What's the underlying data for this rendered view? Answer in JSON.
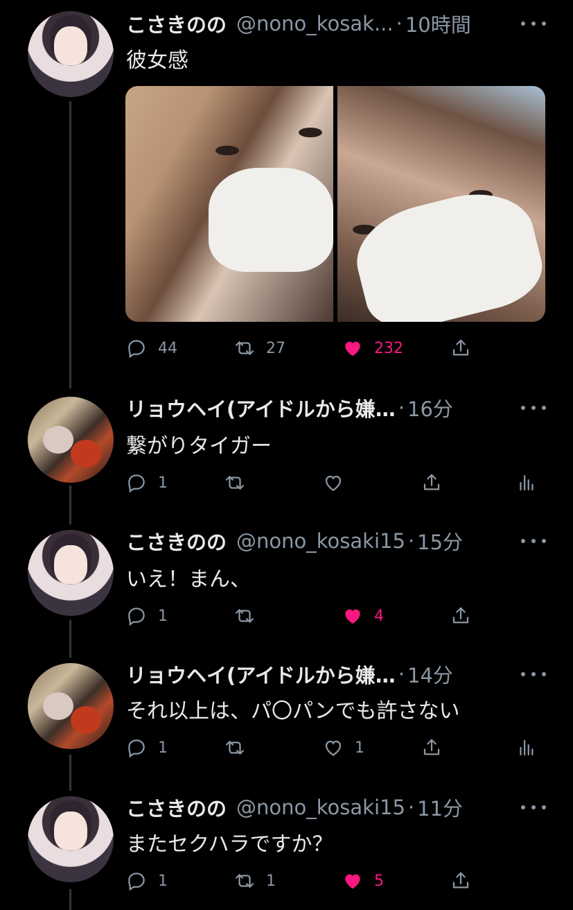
{
  "thread": [
    {
      "kind": "nono",
      "name": "こさきのの",
      "handle": "@nono_kosak...",
      "time": "10時間",
      "text": "彼女感",
      "has_media": true,
      "reply_count": "44",
      "retweet_count": "27",
      "like_count": "232",
      "liked": true
    },
    {
      "kind": "ryohei",
      "name": "リョウヘイ(アイドルから嫌…",
      "handle": "",
      "time": "16分",
      "text": "繋がりタイガー",
      "reply_count": "1",
      "retweet_count": "",
      "like_count": "",
      "liked": false
    },
    {
      "kind": "nono",
      "name": "こさきのの",
      "handle": "@nono_kosaki15",
      "time": "15分",
      "text": "いえ！まん、",
      "reply_count": "1",
      "retweet_count": "",
      "like_count": "4",
      "liked": true
    },
    {
      "kind": "ryohei",
      "name": "リョウヘイ(アイドルから嫌…",
      "handle": "",
      "time": "14分",
      "text": "それ以上は、パ〇パンでも許さない",
      "reply_count": "1",
      "retweet_count": "",
      "like_count": "1",
      "liked": false
    },
    {
      "kind": "nono",
      "name": "こさきのの",
      "handle": "@nono_kosaki15",
      "time": "11分",
      "text": "またセクハラですか？",
      "reply_count": "1",
      "retweet_count": "1",
      "like_count": "5",
      "liked": true
    }
  ],
  "icons": {
    "reply": "reply-icon",
    "retweet": "retweet-icon",
    "like": "heart-icon",
    "share": "share-icon",
    "analytics": "analytics-icon",
    "more": "more-icon"
  },
  "colors": {
    "background": "#000000",
    "text": "#e7e9ea",
    "secondary": "#8b98a5",
    "like": "#f91880",
    "thread_line": "#333639"
  }
}
